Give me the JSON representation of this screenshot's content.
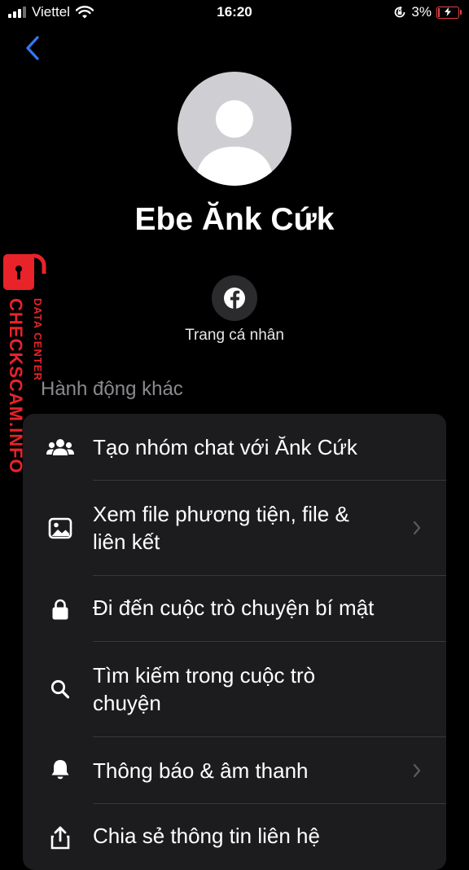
{
  "status_bar": {
    "carrier": "Viettel",
    "time": "16:20",
    "battery_percent": "3%",
    "battery_level": 0.03,
    "icons": [
      "cellular-signal-icon",
      "wifi-icon",
      "orientation-lock-icon",
      "battery-charging-icon"
    ]
  },
  "profile": {
    "name": "Ebe Ănk Cứk",
    "action_label": "Trang cá nhân",
    "action_icon": "facebook-icon"
  },
  "section_header": "Hành động khác",
  "menu": [
    {
      "label": "Tạo nhóm chat với Ănk Cứk",
      "icon": "group-icon",
      "chevron": false
    },
    {
      "label": "Xem file phương tiện, file & liên kết",
      "icon": "image-icon",
      "chevron": true
    },
    {
      "label": "Đi đến cuộc trò chuyện bí mật",
      "icon": "lock-icon",
      "chevron": false
    },
    {
      "label": "Tìm kiếm trong cuộc trò chuyện",
      "icon": "search-icon",
      "chevron": false
    },
    {
      "label": "Thông báo & âm thanh",
      "icon": "bell-icon",
      "chevron": true
    },
    {
      "label": "Chia sẻ thông tin liên hệ",
      "icon": "share-icon",
      "chevron": false
    }
  ],
  "watermark": {
    "brand": "CHECKSCAM.INFO",
    "subtitle": "DATA CENTER"
  },
  "colors": {
    "accent": "#3478f6",
    "background": "#000000",
    "card": "#1c1c1e",
    "muted_text": "#8a8a8e",
    "battery_low": "#e24343",
    "watermark": "#e8232a"
  }
}
